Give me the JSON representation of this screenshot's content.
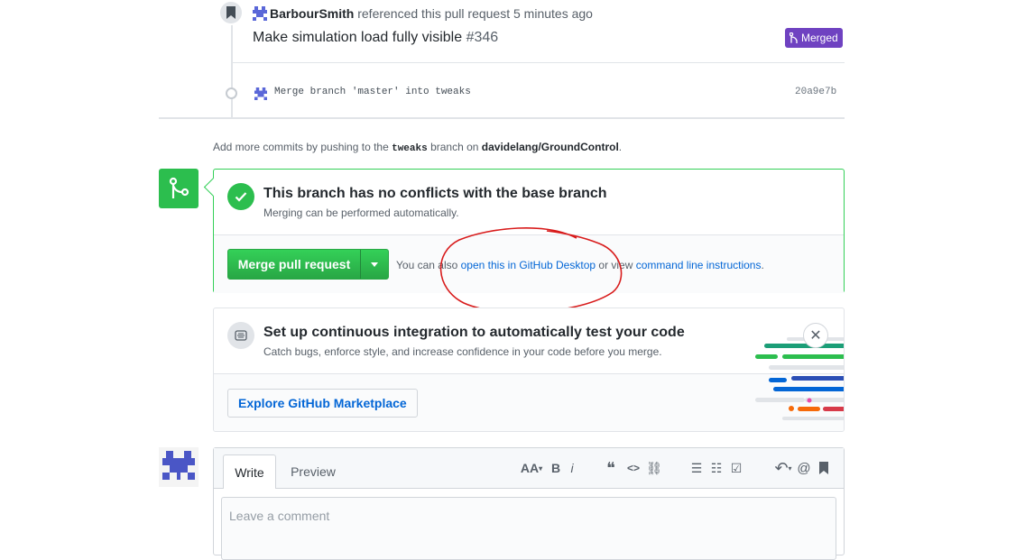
{
  "timeline": {
    "ref_user": "BarbourSmith",
    "ref_text": "referenced this pull request",
    "ref_time": "5 minutes ago",
    "ref_pr_title": "Make simulation load fully visible",
    "ref_pr_number": "#346",
    "merged_label": "Merged",
    "commit_message": "Merge branch 'master' into tweaks",
    "commit_sha": "20a9e7b"
  },
  "add_commits": {
    "prefix": "Add more commits by pushing to the",
    "branch": "tweaks",
    "middle": "branch on",
    "repo": "davidelang/GroundControl",
    "suffix": "."
  },
  "merge_box": {
    "title": "This branch has no conflicts with the base branch",
    "subtitle": "Merging can be performed automatically.",
    "merge_button": "Merge pull request",
    "also_prefix": "You can also",
    "desktop_link": "open this in GitHub Desktop",
    "also_middle": "or view",
    "cli_link": "command line instructions",
    "also_suffix": "."
  },
  "ci_box": {
    "title": "Set up continuous integration to automatically test your code",
    "subtitle": "Catch bugs, enforce style, and increase confidence in your code before you merge.",
    "explore_button": "Explore GitHub Marketplace",
    "close_glyph": "✕"
  },
  "comment": {
    "tab_write": "Write",
    "tab_preview": "Preview",
    "placeholder": "Leave a comment",
    "toolbar": {
      "header": "AA",
      "bold": "B",
      "italic": "i",
      "quote": "❝",
      "code": "<>",
      "link": "⛓",
      "ul": "☰",
      "ol": "☷",
      "task": "☑",
      "reply": "↶",
      "mention": "@",
      "saved": "🔖"
    }
  },
  "colors": {
    "merged": "#6f42c1",
    "success": "#2cbe4e",
    "link": "#0366d6",
    "annotation": "#d81b1b"
  }
}
